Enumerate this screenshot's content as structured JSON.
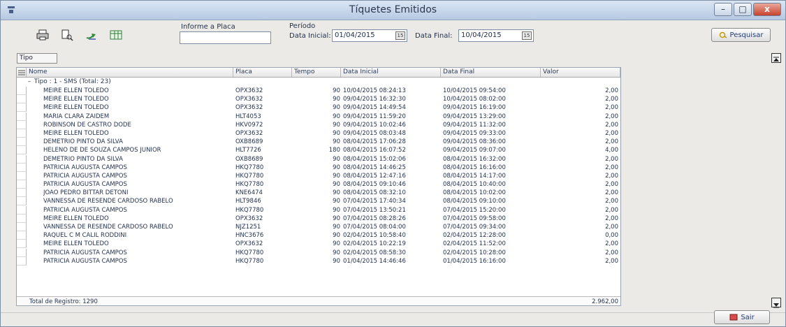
{
  "window": {
    "title": "Tíquetes Emitidos",
    "controls": [
      "–",
      "□",
      "x"
    ]
  },
  "toolbar": {
    "icons": [
      "printer-icon",
      "print-preview-icon",
      "export-icon",
      "spreadsheet-icon"
    ],
    "placa_label": "Informe a Placa",
    "placa_value": "",
    "periodo_label": "Período",
    "data_inicial_label": "Data Inicial:",
    "data_inicial_value": "01/04/2015",
    "data_final_label": "Data Final:",
    "data_final_value": "10/04/2015",
    "pesquisar_label": "Pesquisar"
  },
  "group_box": {
    "label": "Tipo"
  },
  "grid": {
    "columns": [
      "Nome",
      "Placa",
      "Tempo",
      "Data Inicial",
      "Data Final",
      "Valor"
    ],
    "group_row": "Tipo : 1 - SMS (Total: 23)",
    "group_expander": "–",
    "rows": [
      [
        "MEIRE ELLEN TOLEDO",
        "OPX3632",
        "90",
        "10/04/2015 08:24:13",
        "10/04/2015 09:54:00",
        "2,00"
      ],
      [
        "MEIRE ELLEN TOLEDO",
        "OPX3632",
        "90",
        "09/04/2015 16:32:30",
        "10/04/2015 08:02:00",
        "2,00"
      ],
      [
        "MEIRE ELLEN TOLEDO",
        "OPX3632",
        "90",
        "09/04/2015 14:49:54",
        "09/04/2015 16:19:00",
        "2,00"
      ],
      [
        "MARIA CLARA ZAIDEM",
        "HLT4053",
        "90",
        "09/04/2015 11:59:20",
        "09/04/2015 13:29:00",
        "2,00"
      ],
      [
        "ROBINSON DE CASTRO DODE",
        "HKV0972",
        "90",
        "09/04/2015 10:02:46",
        "09/04/2015 11:32:00",
        "2,00"
      ],
      [
        "MEIRE ELLEN TOLEDO",
        "OPX3632",
        "90",
        "09/04/2015 08:03:48",
        "09/04/2015 09:33:00",
        "2,00"
      ],
      [
        "DEMETRIO PINTO DA SILVA",
        "OXB8689",
        "90",
        "08/04/2015 17:06:28",
        "09/04/2015 08:36:00",
        "2,00"
      ],
      [
        "HELENO DE DE SOUZA CAMPOS JUNIOR",
        "HLT7726",
        "180",
        "08/04/2015 16:07:52",
        "09/04/2015 09:07:00",
        "4,00"
      ],
      [
        "DEMETRIO PINTO DA SILVA",
        "OXB8689",
        "90",
        "08/04/2015 15:02:06",
        "08/04/2015 16:32:00",
        "2,00"
      ],
      [
        "PATRICIA AUGUSTA CAMPOS",
        "HKQ7780",
        "90",
        "08/04/2015 14:46:25",
        "08/04/2015 16:16:00",
        "2,00"
      ],
      [
        "PATRICIA AUGUSTA CAMPOS",
        "HKQ7780",
        "90",
        "08/04/2015 12:47:16",
        "08/04/2015 14:17:00",
        "2,00"
      ],
      [
        "PATRICIA AUGUSTA CAMPOS",
        "HKQ7780",
        "90",
        "08/04/2015 09:10:46",
        "08/04/2015 10:40:00",
        "2,00"
      ],
      [
        "JOAO PEDRO BITTAR DETONI",
        "KNE6474",
        "90",
        "08/04/2015 08:32:10",
        "08/04/2015 10:02:00",
        "2,00"
      ],
      [
        "VANNESSA DE RESENDE CARDOSO RABELO",
        "HLT9846",
        "90",
        "07/04/2015 17:40:34",
        "08/04/2015 09:10:00",
        "2,00"
      ],
      [
        "PATRICIA AUGUSTA CAMPOS",
        "HKQ7780",
        "90",
        "07/04/2015 13:50:21",
        "07/04/2015 15:20:00",
        "2,00"
      ],
      [
        "MEIRE ELLEN TOLEDO",
        "OPX3632",
        "90",
        "07/04/2015 08:28:26",
        "07/04/2015 09:58:00",
        "2,00"
      ],
      [
        "VANNESSA DE RESENDE CARDOSO RABELO",
        "NJZ1251",
        "90",
        "07/04/2015 08:04:00",
        "07/04/2015 09:34:00",
        "2,00"
      ],
      [
        "RAQUEL C M CALIL RODDINI",
        "HNC3676",
        "90",
        "02/04/2015 10:58:40",
        "02/04/2015 12:28:00",
        "0,00"
      ],
      [
        "MEIRE ELLEN TOLEDO",
        "OPX3632",
        "90",
        "02/04/2015 10:22:19",
        "02/04/2015 11:52:00",
        "2,00"
      ],
      [
        "PATRICIA AUGUSTA CAMPOS",
        "HKQ7780",
        "90",
        "02/04/2015 08:58:30",
        "02/04/2015 10:28:00",
        "2,00"
      ],
      [
        "PATRICIA AUGUSTA CAMPOS",
        "HKQ7780",
        "90",
        "01/04/2015 14:46:46",
        "01/04/2015 16:16:00",
        "2,00"
      ]
    ],
    "footer_total_label": "Total de Registro: 1290",
    "footer_total_value": "2.962,00"
  },
  "actions": {
    "sair_label": "Sair"
  }
}
